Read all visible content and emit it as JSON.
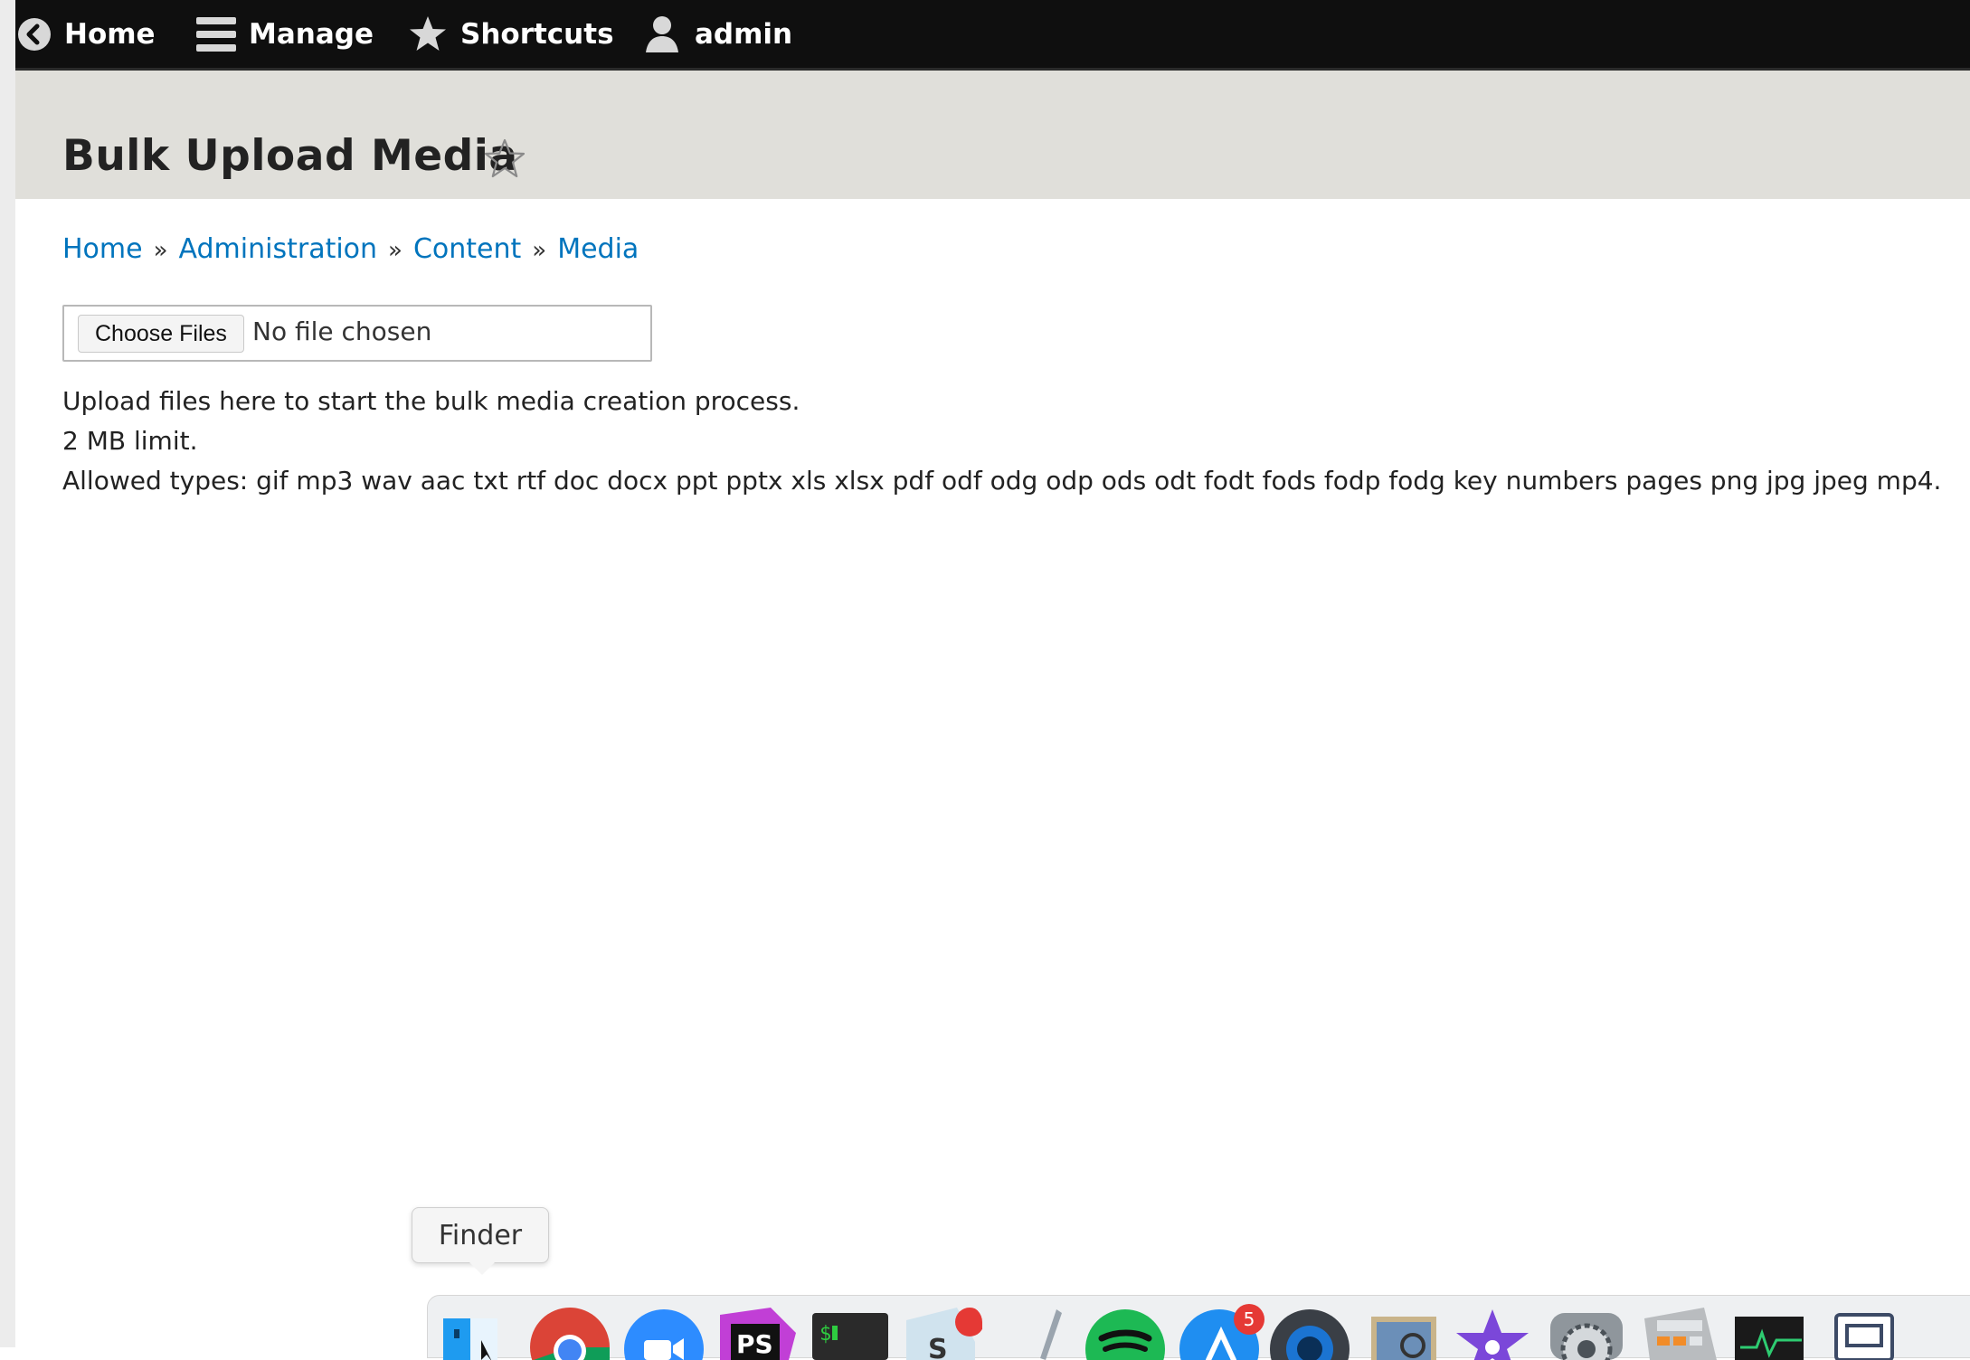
{
  "toolbar": {
    "home_label": "Home",
    "manage_label": "Manage",
    "shortcuts_label": "Shortcuts",
    "user_label": "admin"
  },
  "page": {
    "title": "Bulk Upload Media"
  },
  "breadcrumb": {
    "items": [
      "Home",
      "Administration",
      "Content",
      "Media"
    ],
    "separator": "»"
  },
  "upload": {
    "button_label": "Choose Files",
    "status_text": "No file chosen",
    "help_text": "Upload files here to start the bulk media creation process.",
    "limit_text": "2 MB limit.",
    "allowed_types_text": "Allowed types: gif mp3 wav aac txt rtf doc docx ppt pptx xls xlsx pdf odf odg odp ods odt fodt fods fodp fodg key numbers pages png jpg jpeg mp4."
  },
  "dock": {
    "tooltip": "Finder",
    "icons": [
      "finder-icon",
      "chrome-icon",
      "zoom-icon",
      "phpstorm-icon",
      "terminal-icon",
      "sublime-icon",
      "pen-icon",
      "spotify-icon",
      "app-store-icon",
      "quicktime-icon",
      "preview-icon",
      "imovie-icon",
      "system-preferences-icon",
      "calculator-icon",
      "activity-monitor-icon",
      "screen-sharing-icon"
    ],
    "app_store_badge": "5"
  },
  "colors": {
    "toolbar_bg": "#0f0f0f",
    "header_band": "#e0dfda",
    "link": "#0074bd"
  }
}
